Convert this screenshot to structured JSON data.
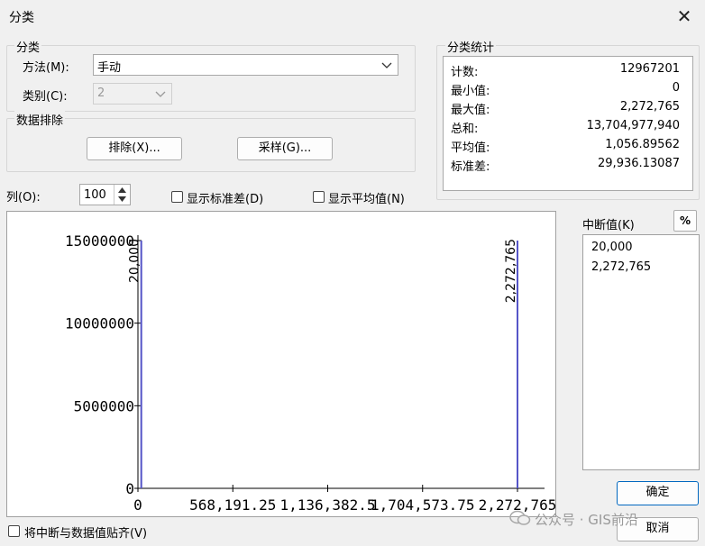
{
  "window": {
    "title": "分类"
  },
  "classify": {
    "group_label": "分类",
    "method_label": "方法(M):",
    "method_value": "手动",
    "classes_label": "类别(C):",
    "classes_value": "2"
  },
  "exclusion": {
    "group_label": "数据排除",
    "exclude_button": "排除(X)...",
    "sample_button": "采样(G)..."
  },
  "stats": {
    "group_label": "分类统计",
    "rows": [
      {
        "label": "计数:",
        "value": "12967201"
      },
      {
        "label": "最小值:",
        "value": "0"
      },
      {
        "label": "最大值:",
        "value": "2,272,765"
      },
      {
        "label": "总和:",
        "value": "13,704,977,940"
      },
      {
        "label": "平均值:",
        "value": "1,056.89562"
      },
      {
        "label": "标准差:",
        "value": "29,936.13087"
      }
    ]
  },
  "controls": {
    "columns_label": "列(O):",
    "columns_value": "100",
    "show_std_label": "显示标准差(D)",
    "show_mean_label": "显示平均值(N)",
    "snap_label": "将中断与数据值贴齐(V)"
  },
  "breaks": {
    "label": "中断值(K)",
    "percent_button": "%",
    "values": [
      "20,000",
      "2,272,765"
    ]
  },
  "buttons": {
    "ok": "确定",
    "cancel": "取消"
  },
  "chart_data": {
    "type": "bar",
    "y_ticks": [
      "15000000",
      "10000000",
      "5000000",
      "0"
    ],
    "y_tick_values": [
      15000000,
      10000000,
      5000000,
      0
    ],
    "ylim": [
      0,
      15000000
    ],
    "x_ticks": [
      "0",
      "568,191.25",
      "1,136,382.5",
      "1,704,573.75",
      "2,272,765"
    ],
    "x_tick_values": [
      0,
      568191.25,
      1136382.5,
      1704573.75,
      2272765
    ],
    "xlim": [
      0,
      2272765
    ],
    "break_values": [
      20000,
      2272765
    ],
    "break_labels": [
      "20,000",
      "2,272,765"
    ],
    "break_color": "#5555c8"
  },
  "watermark": "公众号 · GIS前沿"
}
